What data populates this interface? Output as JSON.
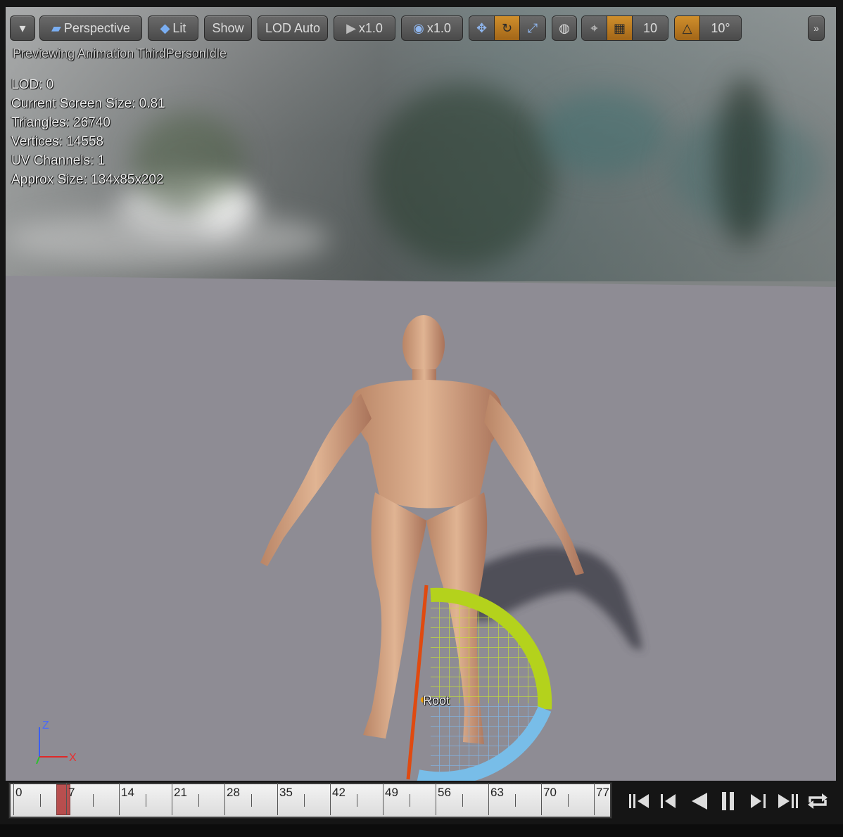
{
  "toolbar": {
    "menu_icon": "chevron-down-icon",
    "perspective_label": "Perspective",
    "lit_label": "Lit",
    "show_label": "Show",
    "lod_label": "LOD Auto",
    "play_speed_label": "x1.0",
    "cam_speed_label": "x1.0",
    "translate_icon": "translate-icon",
    "rotate_icon": "rotate-icon",
    "scale_icon": "scale-icon",
    "world_icon": "globe-icon",
    "surface_snap_icon": "surface-snap-icon",
    "grid_snap_icon": "grid-icon",
    "grid_snap_value": "10",
    "rotate_snap_icon": "angle-icon",
    "rotate_snap_value": "10°",
    "overflow_icon": "double-chevron-right-icon",
    "active_color": "#c98a2a"
  },
  "viewport": {
    "preview_text": "Previewing Animation ThirdPersonIdle",
    "stats": [
      "LOD: 0",
      "Current Screen Size: 0.81",
      "Triangles: 26740",
      "Vertices: 14558",
      "UV Channels: 1",
      "Approx Size: 134x85x202"
    ],
    "bone_label": "Root",
    "axis_z": "Z",
    "axis_x": "X"
  },
  "timeline": {
    "labels": [
      "0",
      "7",
      "14",
      "21",
      "28",
      "35",
      "42",
      "49",
      "56",
      "63",
      "70",
      "77"
    ],
    "current_frame": 7,
    "scrub_color": "#b03434"
  },
  "playback": {
    "buttons": [
      {
        "name": "to-start-button",
        "icon": "skip-to-start-icon"
      },
      {
        "name": "step-back-button",
        "icon": "step-back-icon"
      },
      {
        "name": "play-reverse-button",
        "icon": "play-reverse-icon"
      },
      {
        "name": "pause-button",
        "icon": "pause-icon"
      },
      {
        "name": "step-forward-button",
        "icon": "step-forward-icon"
      },
      {
        "name": "to-end-button",
        "icon": "skip-to-end-icon"
      },
      {
        "name": "loop-button",
        "icon": "loop-icon"
      }
    ]
  }
}
